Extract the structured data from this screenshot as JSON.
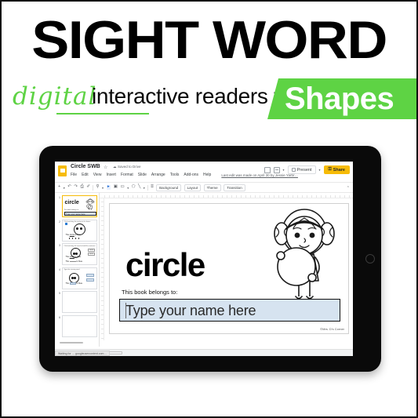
{
  "poster": {
    "title": "SIGHT WORD",
    "subtitle_script": "digital",
    "subtitle_rest": "interactive readers for",
    "banner_label": "Shapes",
    "accent_green": "#5ED344",
    "title_color": "#000000"
  },
  "slides_app": {
    "doc_title": "Circle SWB",
    "star_glyph": "☆",
    "cloud_glyph": "☁",
    "drive_status": "Saved to Drive",
    "menus": [
      "File",
      "Edit",
      "View",
      "Insert",
      "Format",
      "Slide",
      "Arrange",
      "Tools",
      "Add-ons",
      "Help"
    ],
    "last_edit": "Last edit was made on April 30 by Jessie Yarbr…",
    "present_label": "Present",
    "present_caret": "▾",
    "share_label": "Share",
    "share_lock_glyph": "⚿",
    "toolbar": {
      "icons": [
        "+",
        "↶",
        "↷",
        "⎙",
        "✐",
        "⚲",
        "▸",
        "▣",
        "▭",
        "⬠",
        "╲",
        "⌸"
      ],
      "chips": [
        "Background",
        "Layout",
        "Theme",
        "Transition"
      ],
      "layout_caret": "▾",
      "collapse_glyph": "⌃"
    },
    "thumbnails": [
      {
        "num": "1",
        "type": "cover",
        "word": "circle",
        "belongs_label": "This book belongs to:",
        "input_text": "Type your name here"
      },
      {
        "num": "2",
        "type": "sentence",
        "prompt": "Click and drag the circles to the boxes.",
        "sentence_pre": "The ",
        "sentence_word": "circle",
        "sentence_post": " is blue."
      },
      {
        "num": "3",
        "type": "sentence-build",
        "prompt": "Click and drag the word to build the sentence.",
        "sentence_pre": "The ",
        "sentence_word": "circle",
        "sentence_post": " is blue.",
        "line2_pre": "The ",
        "line2_post": " is blue.",
        "chips": [
          "circle",
          "circle"
        ]
      },
      {
        "num": "4",
        "type": "fill-blank",
        "prompt": "Type the missing word.",
        "sentence_pre": "The ",
        "sentence_post": " is blue."
      },
      {
        "num": "5",
        "type": "blank"
      },
      {
        "num": "6",
        "type": "blank"
      }
    ],
    "current_slide": {
      "word": "circle",
      "belongs_label": "This book belongs to:",
      "input_text": "Type your name here",
      "input_fill": "#D6E3F0",
      "copyright": "©Mrs. D's Corner",
      "illustration": "girl-holding-circle"
    },
    "status_url": "Waiting for … googleusercontent.com…"
  },
  "device": {
    "kind": "tablet",
    "home_button": "home-button"
  }
}
